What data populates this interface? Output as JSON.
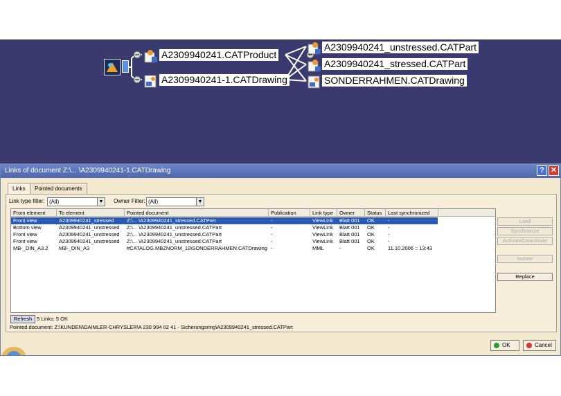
{
  "viewport": {
    "root": {
      "icon": "catia-root-icon"
    },
    "nodes": [
      {
        "label": "A2309940241.CATProduct",
        "icon": "product-icon"
      },
      {
        "label": "A2309940241-1.CATDrawing",
        "icon": "drawing-icon"
      },
      {
        "label": "A2309940241_unstressed.CATPart",
        "icon": "part-icon"
      },
      {
        "label": "A2309940241_stressed.CATPart",
        "icon": "part-icon"
      },
      {
        "label": "SONDERRAHMEN.CATDrawing",
        "icon": "drawing-icon"
      }
    ]
  },
  "dialog": {
    "title": "Links of document Z:\\... \\A2309940241-1.CATDrawing",
    "tabs": [
      {
        "label": "Links",
        "active": true
      },
      {
        "label": "Pointed documents",
        "active": false
      }
    ],
    "filters": {
      "link_type_label": "Link type filter:",
      "link_type_value": "(All)",
      "owner_label": "Owner Filter:",
      "owner_value": "(All)"
    },
    "columns": [
      "From element",
      "To element",
      "Pointed document",
      "Publication",
      "Link type",
      "Owner",
      "Status",
      "Last synchronized"
    ],
    "rows": [
      {
        "from": "Front view",
        "to": "A2309940241_stressed",
        "pointed": "Z:\\... \\A2309940241_stressed.CATPart",
        "publication": "-",
        "link_type": "ViewLink",
        "owner": "Blatt 001",
        "status": "OK",
        "last_sync": "-",
        "selected": true
      },
      {
        "from": "Bottom view",
        "to": "A2309940241_unstressed",
        "pointed": "Z:\\... \\A2309940241_unstressed.CATPart",
        "publication": "-",
        "link_type": "ViewLink",
        "owner": "Blatt 001",
        "status": "OK",
        "last_sync": "-",
        "selected": false
      },
      {
        "from": "Front view",
        "to": "A2309940241_unstressed",
        "pointed": "Z:\\... \\A2309940241_unstressed.CATPart",
        "publication": "-",
        "link_type": "ViewLink",
        "owner": "Blatt 001",
        "status": "OK",
        "last_sync": "-",
        "selected": false
      },
      {
        "from": "Front view",
        "to": "A2309940241_unstressed",
        "pointed": "Z:\\... \\A2309940241_unstressed.CATPart",
        "publication": "-",
        "link_type": "ViewLink",
        "owner": "Blatt 001",
        "status": "OK",
        "last_sync": "-",
        "selected": false
      },
      {
        "from": "MB-_DIN_A3.2",
        "to": "MB-_DIN_A3",
        "pointed": "#CATALOG.MBZNORM_19\\SONDERRAHMEN.CATDrawing",
        "publication": "-",
        "link_type": "MML",
        "owner": "-",
        "status": "OK",
        "last_sync": "11.10.2006 :: 13:43",
        "selected": false
      }
    ],
    "side_buttons": [
      {
        "label": "Load",
        "enabled": false
      },
      {
        "label": "Synchronize",
        "enabled": false
      },
      {
        "label": "Activate/Deactivate",
        "enabled": false
      },
      {
        "label": "Isolate",
        "enabled": false
      },
      {
        "label": "Replace",
        "enabled": true
      }
    ],
    "refresh_label": "Refresh",
    "links_count": "5 Links: 5 OK",
    "pointed_document": "Pointed document: Z:\\KUNDEN\\DAIMLER-CHRYSLER\\A 230 994 02 41 - Sicherungsring\\A2309940241_stressed.CATPart",
    "ok_label": "OK",
    "cancel_label": "Cancel"
  },
  "colors": {
    "viewport_bg": "#3a3a6e",
    "dialog_bg": "#f3e9cf",
    "selection": "#2a59b3",
    "titlebar": "#5b74bb"
  }
}
